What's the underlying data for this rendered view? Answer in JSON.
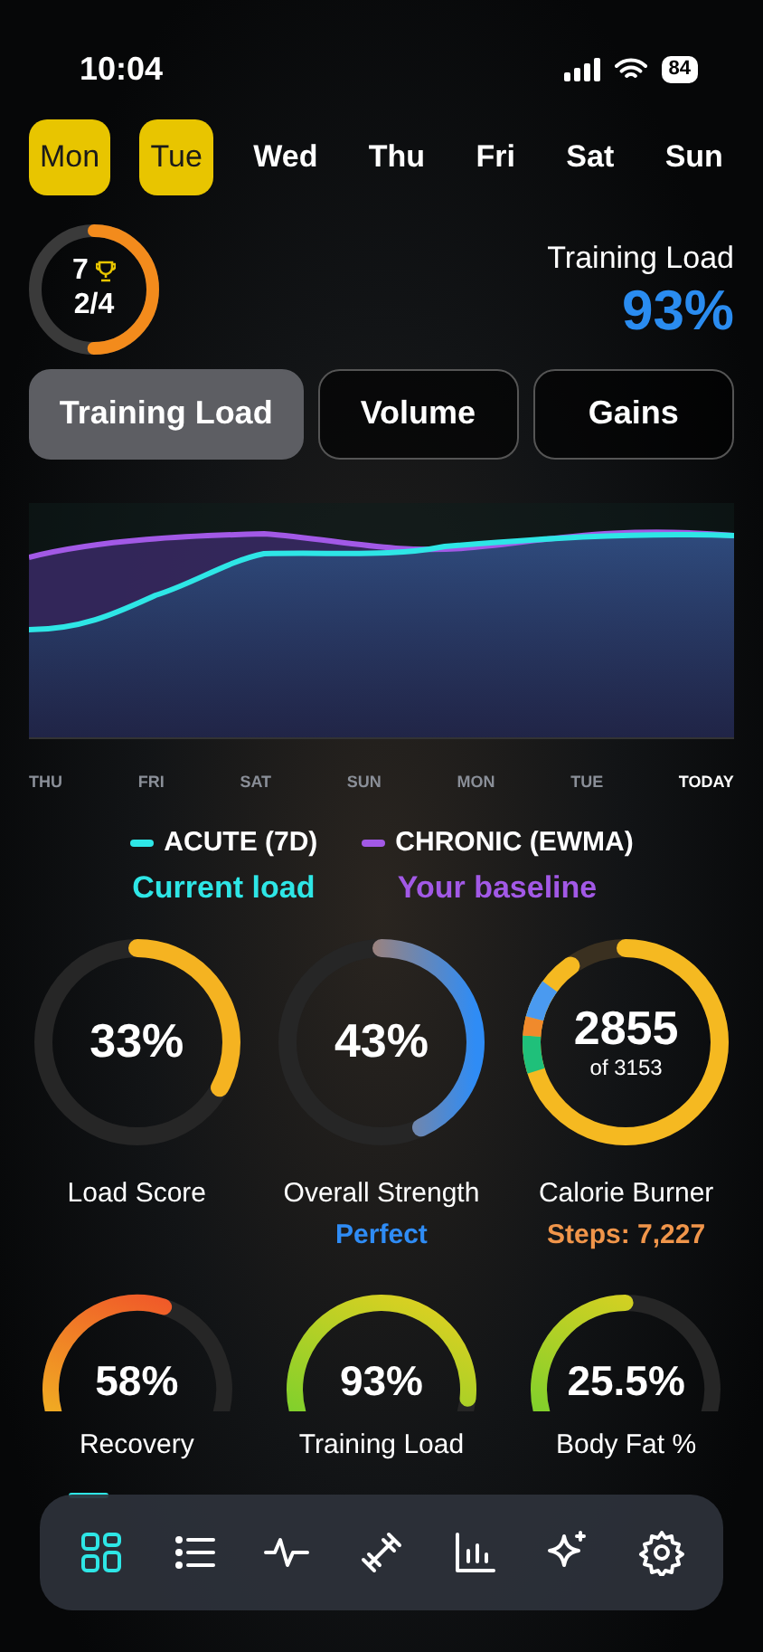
{
  "status_bar": {
    "time": "10:04",
    "battery": "84"
  },
  "days": [
    {
      "label": "Mon",
      "selected": true
    },
    {
      "label": "Tue",
      "selected": true
    },
    {
      "label": "Wed",
      "selected": false
    },
    {
      "label": "Thu",
      "selected": false
    },
    {
      "label": "Fri",
      "selected": false
    },
    {
      "label": "Sat",
      "selected": false
    },
    {
      "label": "Sun",
      "selected": false
    }
  ],
  "streak": {
    "count": "7",
    "progress": "2/4",
    "level": 0.5
  },
  "headline": {
    "label": "Training Load",
    "value": "93%"
  },
  "tabs": [
    {
      "label": "Training Load",
      "selected": true
    },
    {
      "label": "Volume",
      "selected": false
    },
    {
      "label": "Gains",
      "selected": false
    }
  ],
  "chart": {
    "x_labels": [
      "THU",
      "FRI",
      "SAT",
      "SUN",
      "MON",
      "TUE",
      "TODAY"
    ],
    "legend": [
      {
        "name": "ACUTE (7D)",
        "caption": "Current load",
        "color": "#2ee6e6"
      },
      {
        "name": "CHRONIC (EWMA)",
        "caption": "Your baseline",
        "color": "#a259e6"
      }
    ]
  },
  "rings": [
    {
      "kind": "single",
      "value": "33%",
      "label": "Load Score",
      "level": 0.33
    },
    {
      "kind": "gradient",
      "value": "43%",
      "label": "Overall Strength",
      "note": "Perfect",
      "level": 0.43
    },
    {
      "kind": "calorie",
      "value": "2855",
      "sub": "of 3153",
      "label": "Calorie Burner",
      "note": "Steps: 7,227",
      "level": 0.9
    }
  ],
  "gauges": [
    {
      "value": "58%",
      "label": "Recovery",
      "level": 0.58
    },
    {
      "value": "93%",
      "label": "Training Load",
      "level": 0.93
    },
    {
      "value": "25.5%",
      "label": "Body Fat %",
      "level": 0.5
    }
  ],
  "nav": [
    {
      "kind": "grid",
      "selected": true
    },
    {
      "kind": "list",
      "selected": false
    },
    {
      "kind": "pulse",
      "selected": false
    },
    {
      "kind": "dumbbell",
      "selected": false
    },
    {
      "kind": "bars",
      "selected": false
    },
    {
      "kind": "sparkle",
      "selected": false
    },
    {
      "kind": "gear",
      "selected": false
    }
  ]
}
